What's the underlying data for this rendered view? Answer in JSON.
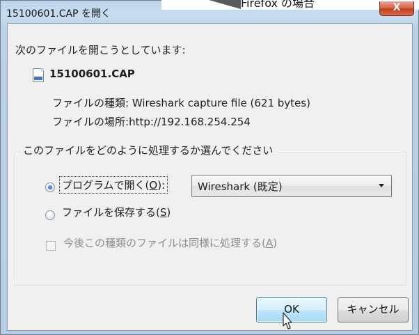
{
  "callout": {
    "text": "Firefox の場合"
  },
  "window": {
    "title": "15100601.CAP を開く",
    "close_label": "X"
  },
  "dialog": {
    "prompt": "次のファイルを開こうとしています:",
    "file_name": "15100601.CAP",
    "file_type_label": "ファイルの種類:",
    "file_type_value": "Wireshark capture file (621 bytes)",
    "file_location_label": "ファイルの場所:",
    "file_location_value": "http://192.168.254.254",
    "group_legend": "このファイルをどのように処理するか選んでください",
    "open_with": {
      "label_prefix": "プログラムで開く(",
      "accesskey": "O",
      "label_suffix": "):",
      "checked": true
    },
    "program_select": {
      "value": "Wireshark (既定)"
    },
    "save_file": {
      "label_prefix": "ファイルを保存する(",
      "accesskey": "S",
      "label_suffix": ")",
      "checked": false
    },
    "remember": {
      "label_prefix": "今後この種類のファイルは同様に処理する(",
      "accesskey": "A",
      "label_suffix": ")",
      "checked": false,
      "disabled": true
    },
    "ok_label": "OK",
    "cancel_label": "キャンセル"
  },
  "icons": {
    "file": "cap-file-icon",
    "cursor": "mouse-pointer-icon",
    "dropdown": "chevron-down-icon"
  }
}
